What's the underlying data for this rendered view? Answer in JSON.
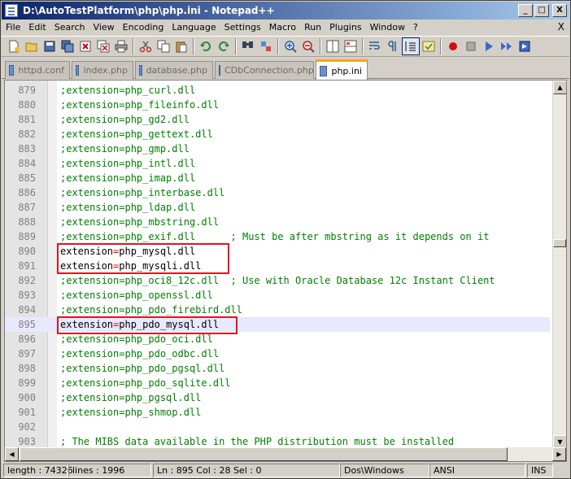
{
  "window": {
    "title": "D:\\AutoTestPlatform\\php\\php.ini - Notepad++",
    "min_glyph": "_",
    "max_glyph": "□",
    "close_glyph": "X"
  },
  "menu": {
    "items": [
      "File",
      "Edit",
      "Search",
      "View",
      "Encoding",
      "Language",
      "Settings",
      "Macro",
      "Run",
      "Plugins",
      "Window",
      "?"
    ],
    "close_glyph": "X"
  },
  "tabs": [
    {
      "label": "httpd.conf",
      "active": false
    },
    {
      "label": "index.php",
      "active": false
    },
    {
      "label": "database.php",
      "active": false
    },
    {
      "label": "CDbConnection.php",
      "active": false
    },
    {
      "label": "php.ini",
      "active": true
    }
  ],
  "editor": {
    "lines": [
      {
        "num": "879",
        "comment": true,
        "key": ";extension",
        "val": "php_curl.dll",
        "tail": ""
      },
      {
        "num": "880",
        "comment": true,
        "key": ";extension",
        "val": "php_fileinfo.dll",
        "tail": ""
      },
      {
        "num": "881",
        "comment": true,
        "key": ";extension",
        "val": "php_gd2.dll",
        "tail": ""
      },
      {
        "num": "882",
        "comment": true,
        "key": ";extension",
        "val": "php_gettext.dll",
        "tail": ""
      },
      {
        "num": "883",
        "comment": true,
        "key": ";extension",
        "val": "php_gmp.dll",
        "tail": ""
      },
      {
        "num": "884",
        "comment": true,
        "key": ";extension",
        "val": "php_intl.dll",
        "tail": ""
      },
      {
        "num": "885",
        "comment": true,
        "key": ";extension",
        "val": "php_imap.dll",
        "tail": ""
      },
      {
        "num": "886",
        "comment": true,
        "key": ";extension",
        "val": "php_interbase.dll",
        "tail": ""
      },
      {
        "num": "887",
        "comment": true,
        "key": ";extension",
        "val": "php_ldap.dll",
        "tail": ""
      },
      {
        "num": "888",
        "comment": true,
        "key": ";extension",
        "val": "php_mbstring.dll",
        "tail": ""
      },
      {
        "num": "889",
        "comment": true,
        "key": ";extension",
        "val": "php_exif.dll",
        "tail": "      ; Must be after mbstring as it depends on it"
      },
      {
        "num": "890",
        "comment": false,
        "key": "extension",
        "val": "php_mysql.dll",
        "tail": ""
      },
      {
        "num": "891",
        "comment": false,
        "key": "extension",
        "val": "php_mysqli.dll",
        "tail": ""
      },
      {
        "num": "892",
        "comment": true,
        "key": ";extension",
        "val": "php_oci8_12c.dll",
        "tail": "  ; Use with Oracle Database 12c Instant Client"
      },
      {
        "num": "893",
        "comment": true,
        "key": ";extension",
        "val": "php_openssl.dll",
        "tail": ""
      },
      {
        "num": "894",
        "comment": true,
        "key": ";extension",
        "val": "php_pdo_firebird.dll",
        "tail": ""
      },
      {
        "num": "895",
        "comment": false,
        "key": "extension",
        "val": "php_pdo_mysql.dll",
        "tail": "",
        "current": true
      },
      {
        "num": "896",
        "comment": true,
        "key": ";extension",
        "val": "php_pdo_oci.dll",
        "tail": ""
      },
      {
        "num": "897",
        "comment": true,
        "key": ";extension",
        "val": "php_pdo_odbc.dll",
        "tail": ""
      },
      {
        "num": "898",
        "comment": true,
        "key": ";extension",
        "val": "php_pdo_pgsql.dll",
        "tail": ""
      },
      {
        "num": "899",
        "comment": true,
        "key": ";extension",
        "val": "php_pdo_sqlite.dll",
        "tail": ""
      },
      {
        "num": "900",
        "comment": true,
        "key": ";extension",
        "val": "php_pgsql.dll",
        "tail": ""
      },
      {
        "num": "901",
        "comment": true,
        "key": ";extension",
        "val": "php_shmop.dll",
        "tail": ""
      },
      {
        "num": "902",
        "comment": false,
        "key": "",
        "val": "",
        "tail": ""
      },
      {
        "num": "903",
        "comment": true,
        "key": "; The MIBS data available in the PHP distribution must be installed",
        "val": "",
        "tail": "",
        "plain": true
      }
    ]
  },
  "status": {
    "length": "length : 74326",
    "lines": "lines : 1996",
    "position": "Ln : 895   Col : 28   Sel : 0",
    "eol": "Dos\\Windows",
    "encoding": "ANSI",
    "mode": "INS"
  },
  "colors": {
    "comment": "#008000",
    "operator": "#ff0000",
    "highlight_box": "#e0141e",
    "title_gradient_start": "#0a246a",
    "active_tab_accent": "#f5a623"
  }
}
